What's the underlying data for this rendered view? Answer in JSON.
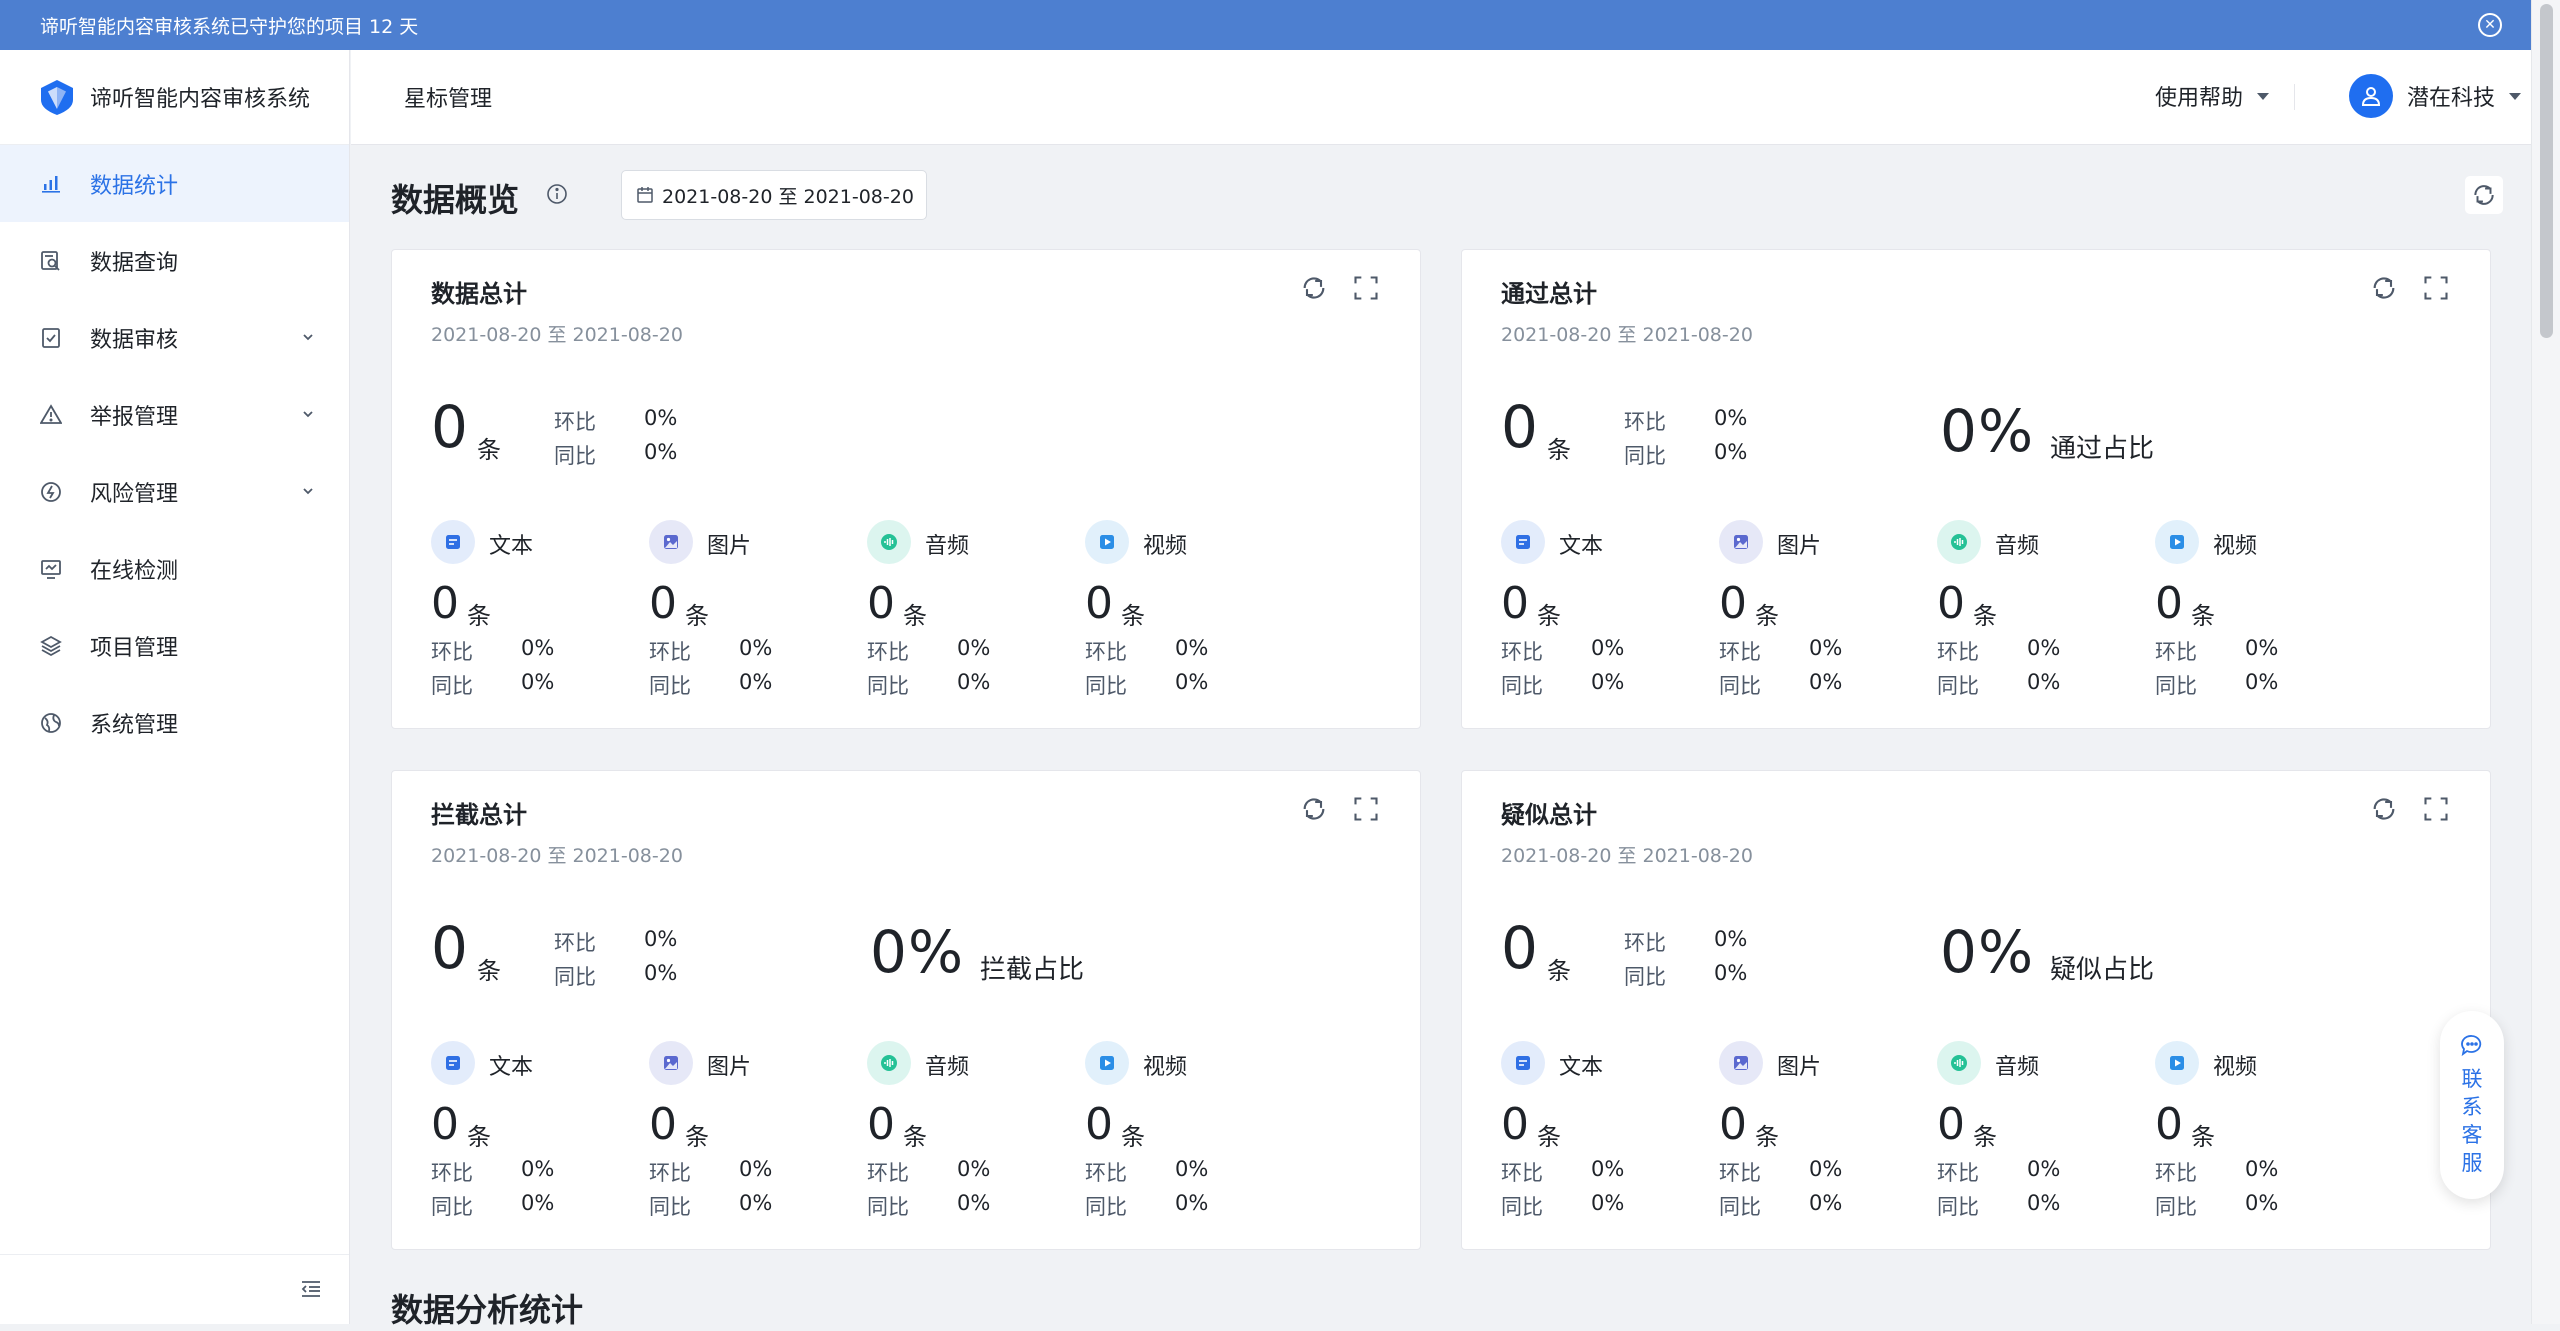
{
  "banner": {
    "text": "谛听智能内容审核系统已守护您的项目 12 天",
    "close_icon": "close-circle-icon"
  },
  "brand": {
    "name": "谛听智能内容审核系统",
    "logo": "shield-logo"
  },
  "sidebar": {
    "items": [
      {
        "label": "数据统计",
        "icon": "bar-chart-icon",
        "active": true,
        "expandable": false
      },
      {
        "label": "数据查询",
        "icon": "search-doc-icon",
        "active": false,
        "expandable": false
      },
      {
        "label": "数据审核",
        "icon": "check-doc-icon",
        "active": false,
        "expandable": true
      },
      {
        "label": "举报管理",
        "icon": "warning-icon",
        "active": false,
        "expandable": true
      },
      {
        "label": "风险管理",
        "icon": "risk-icon",
        "active": false,
        "expandable": true
      },
      {
        "label": "在线检测",
        "icon": "monitor-icon",
        "active": false,
        "expandable": false
      },
      {
        "label": "项目管理",
        "icon": "layers-icon",
        "active": false,
        "expandable": false
      },
      {
        "label": "系统管理",
        "icon": "globe-icon",
        "active": false,
        "expandable": false
      }
    ]
  },
  "header": {
    "breadcrumb": "星标管理",
    "help": "使用帮助",
    "user": "潜在科技"
  },
  "overview": {
    "title": "数据概览",
    "date_range": "2021-08-20 至 2021-08-20"
  },
  "cards": [
    {
      "title": "数据总计",
      "date": "2021-08-20 至 2021-08-20",
      "total": "0",
      "unit": "条",
      "hb_label": "环比",
      "hb_value": "0%",
      "tb_label": "同比",
      "tb_value": "0%",
      "pct": null,
      "pct_label": null,
      "subs": [
        {
          "name": "文本",
          "num": "0",
          "unit": "条",
          "hb_label": "环比",
          "hb": "0%",
          "tb_label": "同比",
          "tb": "0%"
        },
        {
          "name": "图片",
          "num": "0",
          "unit": "条",
          "hb_label": "环比",
          "hb": "0%",
          "tb_label": "同比",
          "tb": "0%"
        },
        {
          "name": "音频",
          "num": "0",
          "unit": "条",
          "hb_label": "环比",
          "hb": "0%",
          "tb_label": "同比",
          "tb": "0%"
        },
        {
          "name": "视频",
          "num": "0",
          "unit": "条",
          "hb_label": "环比",
          "hb": "0%",
          "tb_label": "同比",
          "tb": "0%"
        }
      ]
    },
    {
      "title": "通过总计",
      "date": "2021-08-20 至 2021-08-20",
      "total": "0",
      "unit": "条",
      "hb_label": "环比",
      "hb_value": "0%",
      "tb_label": "同比",
      "tb_value": "0%",
      "pct": "0",
      "pct_sign": "%",
      "pct_label": "通过占比",
      "subs": [
        {
          "name": "文本",
          "num": "0",
          "unit": "条",
          "hb_label": "环比",
          "hb": "0%",
          "tb_label": "同比",
          "tb": "0%"
        },
        {
          "name": "图片",
          "num": "0",
          "unit": "条",
          "hb_label": "环比",
          "hb": "0%",
          "tb_label": "同比",
          "tb": "0%"
        },
        {
          "name": "音频",
          "num": "0",
          "unit": "条",
          "hb_label": "环比",
          "hb": "0%",
          "tb_label": "同比",
          "tb": "0%"
        },
        {
          "name": "视频",
          "num": "0",
          "unit": "条",
          "hb_label": "环比",
          "hb": "0%",
          "tb_label": "同比",
          "tb": "0%"
        }
      ]
    },
    {
      "title": "拦截总计",
      "date": "2021-08-20 至 2021-08-20",
      "total": "0",
      "unit": "条",
      "hb_label": "环比",
      "hb_value": "0%",
      "tb_label": "同比",
      "tb_value": "0%",
      "pct": "0",
      "pct_sign": "%",
      "pct_label": "拦截占比",
      "subs": [
        {
          "name": "文本",
          "num": "0",
          "unit": "条",
          "hb_label": "环比",
          "hb": "0%",
          "tb_label": "同比",
          "tb": "0%"
        },
        {
          "name": "图片",
          "num": "0",
          "unit": "条",
          "hb_label": "环比",
          "hb": "0%",
          "tb_label": "同比",
          "tb": "0%"
        },
        {
          "name": "音频",
          "num": "0",
          "unit": "条",
          "hb_label": "环比",
          "hb": "0%",
          "tb_label": "同比",
          "tb": "0%"
        },
        {
          "name": "视频",
          "num": "0",
          "unit": "条",
          "hb_label": "环比",
          "hb": "0%",
          "tb_label": "同比",
          "tb": "0%"
        }
      ]
    },
    {
      "title": "疑似总计",
      "date": "2021-08-20 至 2021-08-20",
      "total": "0",
      "unit": "条",
      "hb_label": "环比",
      "hb_value": "0%",
      "tb_label": "同比",
      "tb_value": "0%",
      "pct": "0",
      "pct_sign": "%",
      "pct_label": "疑似占比",
      "subs": [
        {
          "name": "文本",
          "num": "0",
          "unit": "条",
          "hb_label": "环比",
          "hb": "0%",
          "tb_label": "同比",
          "tb": "0%"
        },
        {
          "name": "图片",
          "num": "0",
          "unit": "条",
          "hb_label": "环比",
          "hb": "0%",
          "tb_label": "同比",
          "tb": "0%"
        },
        {
          "name": "音频",
          "num": "0",
          "unit": "条",
          "hb_label": "环比",
          "hb": "0%",
          "tb_label": "同比",
          "tb": "0%"
        },
        {
          "name": "视频",
          "num": "0",
          "unit": "条",
          "hb_label": "环比",
          "hb": "0%",
          "tb_label": "同比",
          "tb": "0%"
        }
      ]
    }
  ],
  "section2": {
    "title": "数据分析统计"
  },
  "support": {
    "label": "联系客服",
    "icon": "chat-bubble-icon"
  },
  "colors": {
    "banner": "#4d7fd0",
    "accent": "#2b72e6",
    "active_bg": "#edf3fd",
    "text_ico_bg": "#e3ecfb",
    "image_ico_bg": "#e6e8f7",
    "audio_ico_bg": "#dcf5ef",
    "video_ico_bg": "#e1f0fb"
  }
}
